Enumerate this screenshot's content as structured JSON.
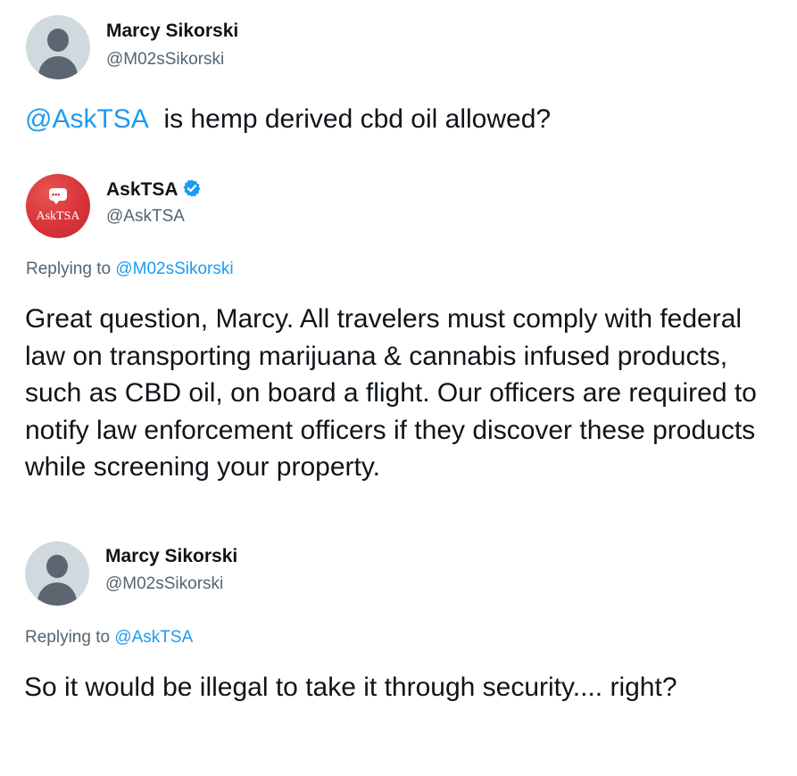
{
  "tweets": [
    {
      "author": {
        "name": "Marcy Sikorski",
        "handle": "@M02sSikorski",
        "avatar": "default-person-icon"
      },
      "mention": "@AskTSA",
      "text": "is hemp derived cbd oil allowed?"
    },
    {
      "author": {
        "name": "AskTSA",
        "handle": "@AskTSA",
        "avatar": "asktsa-logo",
        "avatar_text": "AskTSA",
        "verified": true
      },
      "replying_label": "Replying to",
      "replying_to": "@M02sSikorski",
      "text": "Great question, Marcy. All travelers must comply with federal law on transporting marijuana & cannabis infused products, such as CBD oil, on board a flight. Our officers are required to notify law enforcement officers if they discover these products while screening your property."
    },
    {
      "author": {
        "name": "Marcy Sikorski",
        "handle": "@M02sSikorski",
        "avatar": "default-person-icon"
      },
      "replying_label": "Replying to",
      "replying_to": "@AskTSA",
      "text": "So it would be illegal to take it through security.... right?"
    }
  ],
  "colors": {
    "link": "#1d9bf0",
    "text": "#0f1419",
    "secondary": "#536471",
    "verified_badge": "#1d9bf0",
    "brand_avatar": "#d8343a"
  }
}
